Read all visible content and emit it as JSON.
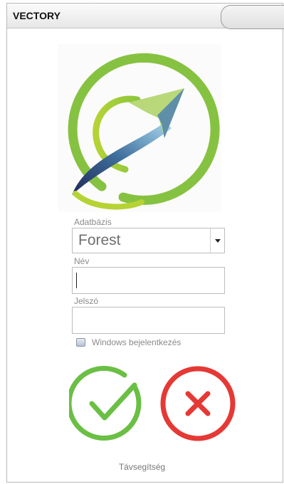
{
  "window": {
    "title": "VECTORY"
  },
  "form": {
    "database_label": "Adatbázis",
    "database_value": "Forest",
    "name_label": "Név",
    "name_value": "",
    "password_label": "Jelszó",
    "password_value": "",
    "windows_login_label": "Windows bejelentkezés",
    "windows_login_checked": false
  },
  "actions": {
    "confirm_icon": "check-icon",
    "cancel_icon": "close-icon"
  },
  "footer": {
    "remote_help_label": "Távsegítség"
  },
  "colors": {
    "logo_green": "#8cc63f",
    "logo_blue": "#2b4a7e",
    "confirm_green": "#6abf44",
    "cancel_red": "#e53935"
  }
}
